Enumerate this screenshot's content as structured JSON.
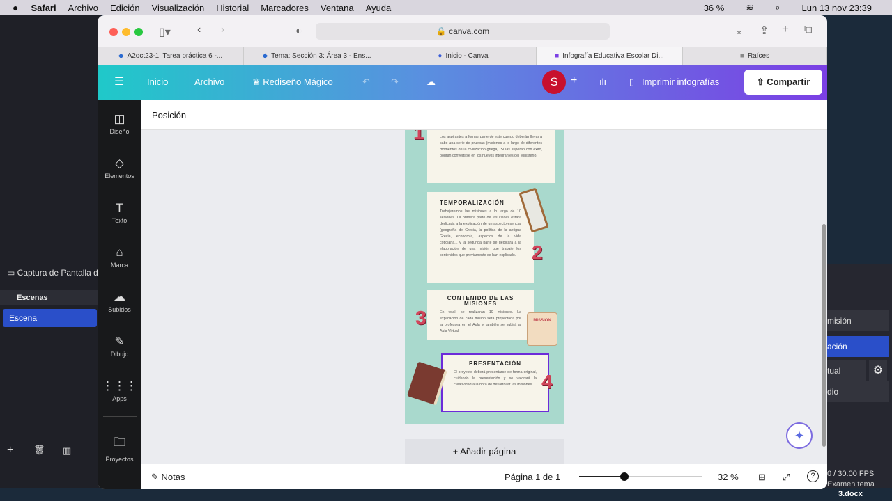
{
  "menubar": {
    "app": "Safari",
    "items": [
      "Archivo",
      "Edición",
      "Visualización",
      "Historial",
      "Marcadores",
      "Ventana",
      "Ayuda"
    ],
    "battery": "36 %",
    "datetime": "Lun 13 nov 23:39"
  },
  "obs": {
    "source": "Captura de Pantalla d",
    "scenes_title": "Escenas",
    "scene": "Escena",
    "controls": [
      "misión",
      "ación",
      "tual",
      "dio"
    ],
    "fps": "0 / 30.00 FPS",
    "file": "Examen tema",
    "file2": "3.docx"
  },
  "browser": {
    "url": "canva.com",
    "tabs": [
      "A2oct23-1: Tarea práctica 6 -...",
      "Tema: Sección 3: Área 3 - Ens...",
      "Inicio - Canva",
      "Infografía Educativa Escolar Di...",
      "Raíces"
    ]
  },
  "canva": {
    "menu": [
      "Inicio",
      "Archivo",
      "Rediseño Mágico"
    ],
    "avatar": "S",
    "print": "Imprimir infografías",
    "share": "Compartir",
    "position": "Posición",
    "sidebar": [
      "Diseño",
      "Elementos",
      "Texto",
      "Marca",
      "Subidos",
      "Dibujo",
      "Apps",
      "Proyectos"
    ],
    "add_page": "+ Añadir página",
    "notes": "Notas",
    "page": "Página 1 de 1",
    "zoom": "32 %",
    "zoom_value": 32
  },
  "infographic": {
    "intro": "Los aspirantes a formar parte de este cuerpo deberán llevar a cabo una serie de pruebas (misiones a lo largo de diferentes momentos de la civilización griega). Si las superan con éxito, podrán convertirse en los nuevos integrantes del Ministerio.",
    "sections": [
      {
        "num": "2",
        "title": "TEMPORALIZACIÓN",
        "text": "Trabajaremos las misiones a lo largo de 10 sesiones. La primera parte de las clases estará dedicada a la explicación de un aspecto esencial (geografía de Grecia, la política de la antigua Grecia, economía, aspectos de la vida cotidiana... y la segunda parte se dedicará a la elaboración de una misión que trabaje los contenidos que previamente se han explicado."
      },
      {
        "num": "3",
        "title": "CONTENIDO DE LAS MISIONES",
        "text": "En total, se realizarán 10 misiones. La explicación de cada misión será proyectada por la profesora en el Aula y también se subirá al Aula Virtual.",
        "sticker": "MISSION"
      },
      {
        "num": "4",
        "title": "PRESENTACIÓN",
        "text": "El proyecto deberá presentarse de forma original, cuidando la presentación y se valorará la creatividad a la hora de desarrollar las misiones."
      }
    ]
  }
}
